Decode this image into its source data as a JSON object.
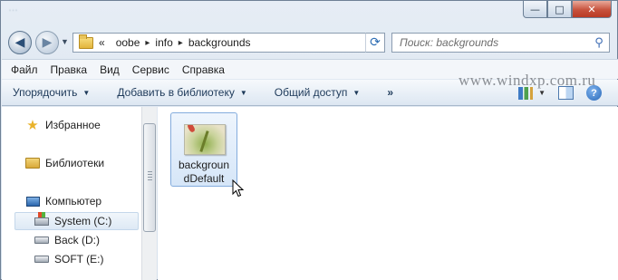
{
  "window": {
    "background_text": "…",
    "caption_buttons": {
      "minimize": "—",
      "maximize": "□",
      "close": "✕"
    }
  },
  "address_bar": {
    "overflow": "«",
    "crumbs": [
      "oobe",
      "info",
      "backgrounds"
    ],
    "separator": "▸"
  },
  "search": {
    "placeholder": "Поиск: backgrounds"
  },
  "menu": [
    "Файл",
    "Правка",
    "Вид",
    "Сервис",
    "Справка"
  ],
  "toolbar": {
    "organize": "Упорядочить",
    "add_to_library": "Добавить в библиотеку",
    "share": "Общий доступ",
    "more": "»"
  },
  "watermark": "www.windxp.com.ru",
  "nav_pane": {
    "favorites": "Избранное",
    "libraries": "Библиотеки",
    "computer": "Компьютер",
    "drives": [
      "System (C:)",
      "Back (D:)",
      "SOFT (E:)"
    ]
  },
  "files": [
    {
      "name_line1": "backgroun",
      "name_line2": "dDefault"
    }
  ],
  "icons": {
    "back": "back-arrow-icon",
    "forward": "forward-arrow-icon",
    "refresh": "refresh-icon",
    "search": "search-icon",
    "help": "help-icon"
  }
}
